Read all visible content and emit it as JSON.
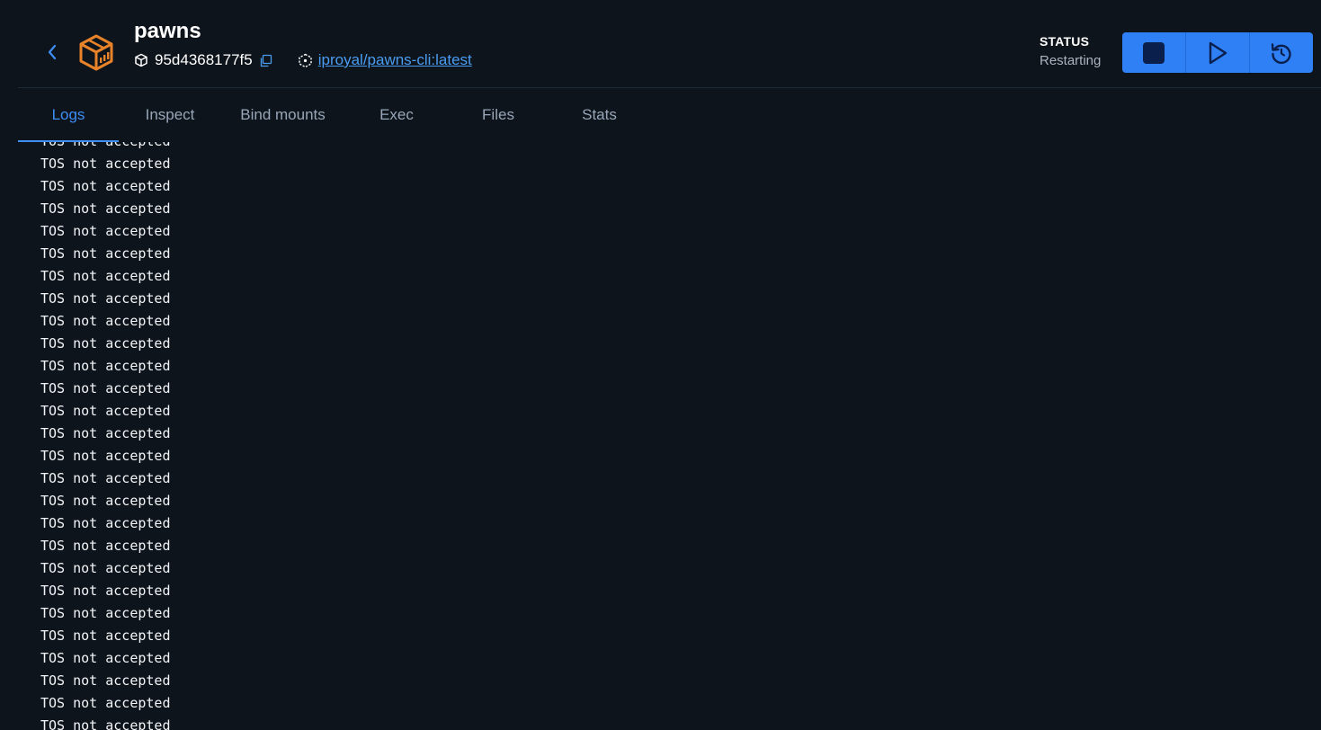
{
  "container": {
    "name": "pawns",
    "id": "95d4368177f5",
    "image": "iproyal/pawns-cli:latest"
  },
  "status": {
    "label": "STATUS",
    "value": "Restarting"
  },
  "actions": {
    "stop_icon": "stop-icon",
    "start_icon": "play-icon",
    "restart_icon": "restart-icon"
  },
  "tabs": [
    {
      "label": "Logs",
      "active": true
    },
    {
      "label": "Inspect",
      "active": false
    },
    {
      "label": "Bind mounts",
      "active": false
    },
    {
      "label": "Exec",
      "active": false
    },
    {
      "label": "Files",
      "active": false
    },
    {
      "label": "Stats",
      "active": false
    }
  ],
  "logs": {
    "lines": [
      "TOS not accepted",
      "TOS not accepted",
      "TOS not accepted",
      "TOS not accepted",
      "TOS not accepted",
      "TOS not accepted",
      "TOS not accepted",
      "TOS not accepted",
      "TOS not accepted",
      "TOS not accepted",
      "TOS not accepted",
      "TOS not accepted",
      "TOS not accepted",
      "TOS not accepted",
      "TOS not accepted",
      "TOS not accepted",
      "TOS not accepted",
      "TOS not accepted",
      "TOS not accepted",
      "TOS not accepted",
      "TOS not accepted",
      "TOS not accepted",
      "TOS not accepted",
      "TOS not accepted",
      "TOS not accepted",
      "TOS not accepted",
      "TOS not accepted"
    ]
  },
  "colors": {
    "background": "#0e141b",
    "accent": "#2f80f5",
    "logo": "#e8832a",
    "link": "#4a9cf0"
  }
}
